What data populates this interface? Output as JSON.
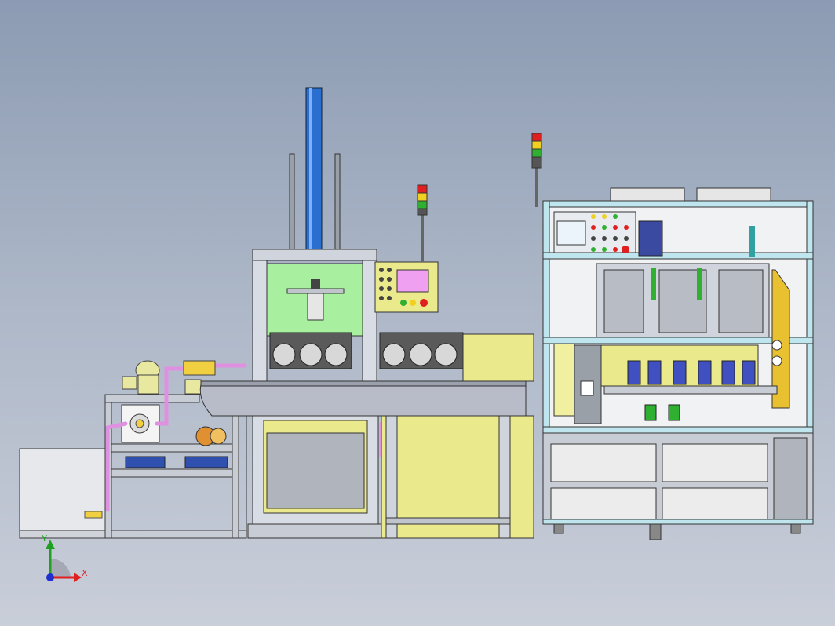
{
  "viewport": {
    "background_top": "#8c9bb3",
    "background_bottom": "#c9ced9"
  },
  "triad": {
    "x_label": "X",
    "y_label": "Y",
    "x_color": "#e02020",
    "y_color": "#20a020",
    "z_color": "#2030d0"
  },
  "palette": {
    "frame": "#d8dce4",
    "frame_edge": "#3a3a3a",
    "green_panel": "#a8f0a0",
    "yellow_panel": "#eaea8c",
    "cyan_frame": "#bfe6ee",
    "blue_cylinder": "#2a6fd0",
    "pink_tube": "#e090e0",
    "hmi_screen_pink": "#f0a0f0",
    "lamp_red": "#e02020",
    "lamp_yellow": "#f0d020",
    "lamp_green": "#30b030"
  },
  "icons": {
    "stack_light_left": "stack-light-icon",
    "stack_light_right": "stack-light-icon",
    "triad": "coordinate-triad-icon"
  }
}
